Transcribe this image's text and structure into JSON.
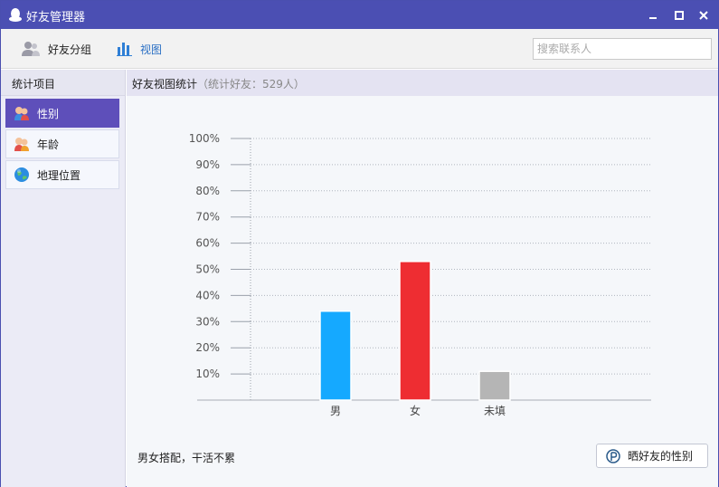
{
  "window": {
    "title": "好友管理器"
  },
  "toolbar": {
    "groups_label": "好友分组",
    "view_label": "视图",
    "search_placeholder": "搜索联系人"
  },
  "sidebar": {
    "header": "统计项目",
    "items": [
      {
        "label": "性别",
        "icon": "gender-icon",
        "active": true
      },
      {
        "label": "年龄",
        "icon": "age-icon",
        "active": false
      },
      {
        "label": "地理位置",
        "icon": "globe-icon",
        "active": false
      }
    ]
  },
  "content": {
    "title": "好友视图统计",
    "subtitle": "（统计好友：529人）",
    "footer_text": "男女搭配，干活不累",
    "share_label": "晒好友的性别"
  },
  "colors": {
    "titlebar": "#4b4fb3",
    "active_item": "#5e4fba",
    "male": "#15a9ff",
    "female": "#ee2d32",
    "unknown": "#b5b5b5"
  },
  "chart_data": {
    "type": "bar",
    "categories": [
      "男",
      "女",
      "未填"
    ],
    "values": [
      34,
      53,
      11
    ],
    "ylim": [
      0,
      100
    ],
    "yticks": [
      "10%",
      "20%",
      "30%",
      "40%",
      "50%",
      "60%",
      "70%",
      "80%",
      "90%",
      "100%"
    ],
    "ytick_values": [
      10,
      20,
      30,
      40,
      50,
      60,
      70,
      80,
      90,
      100
    ],
    "grid": true
  }
}
